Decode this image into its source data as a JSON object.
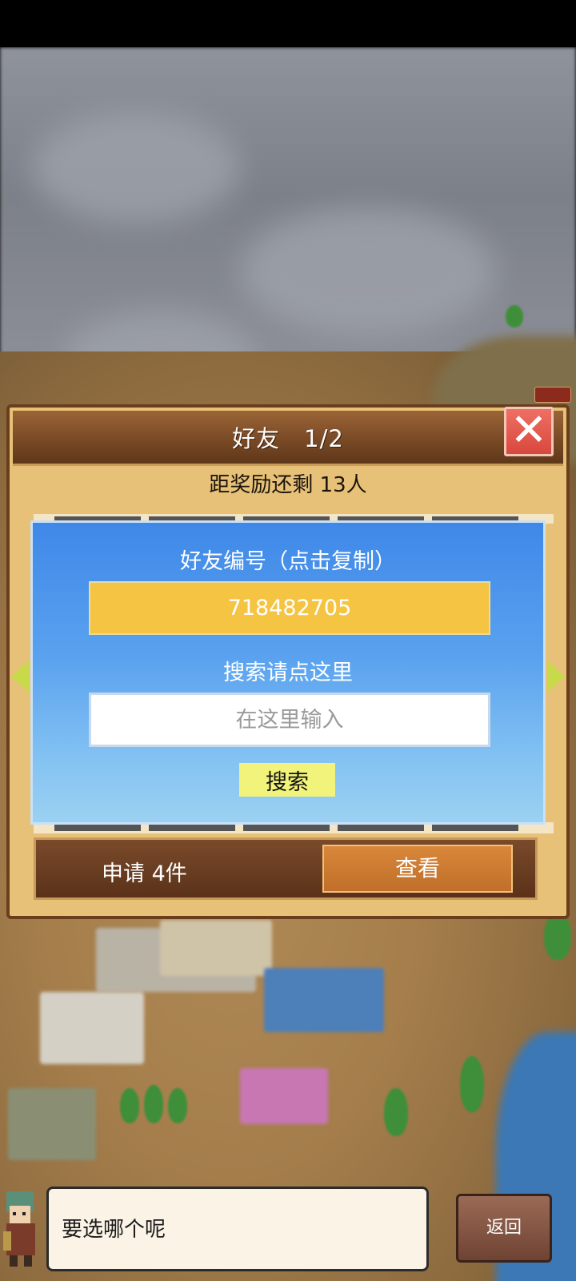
{
  "dialog": {
    "title": "好友",
    "page": "1/2",
    "remaining_text": "距奖励还剩 13人",
    "close_icon": "close-icon"
  },
  "friend_panel": {
    "id_label": "好友编号（点击复制）",
    "friend_id": "718482705",
    "search_label": "搜索请点这里",
    "search_placeholder": "在这里输入",
    "search_button": "搜索"
  },
  "requests": {
    "text": "申请 4件",
    "view_button": "查看"
  },
  "dialogue": {
    "message": "要选哪个呢",
    "back_button": "返回"
  },
  "colors": {
    "title_bar": "#7a4a26",
    "panel_blue": "#5aa2ef",
    "id_box": "#f5c443",
    "close_red": "#e0564b",
    "search_button": "#f2f37a",
    "view_button": "#d9873a"
  }
}
